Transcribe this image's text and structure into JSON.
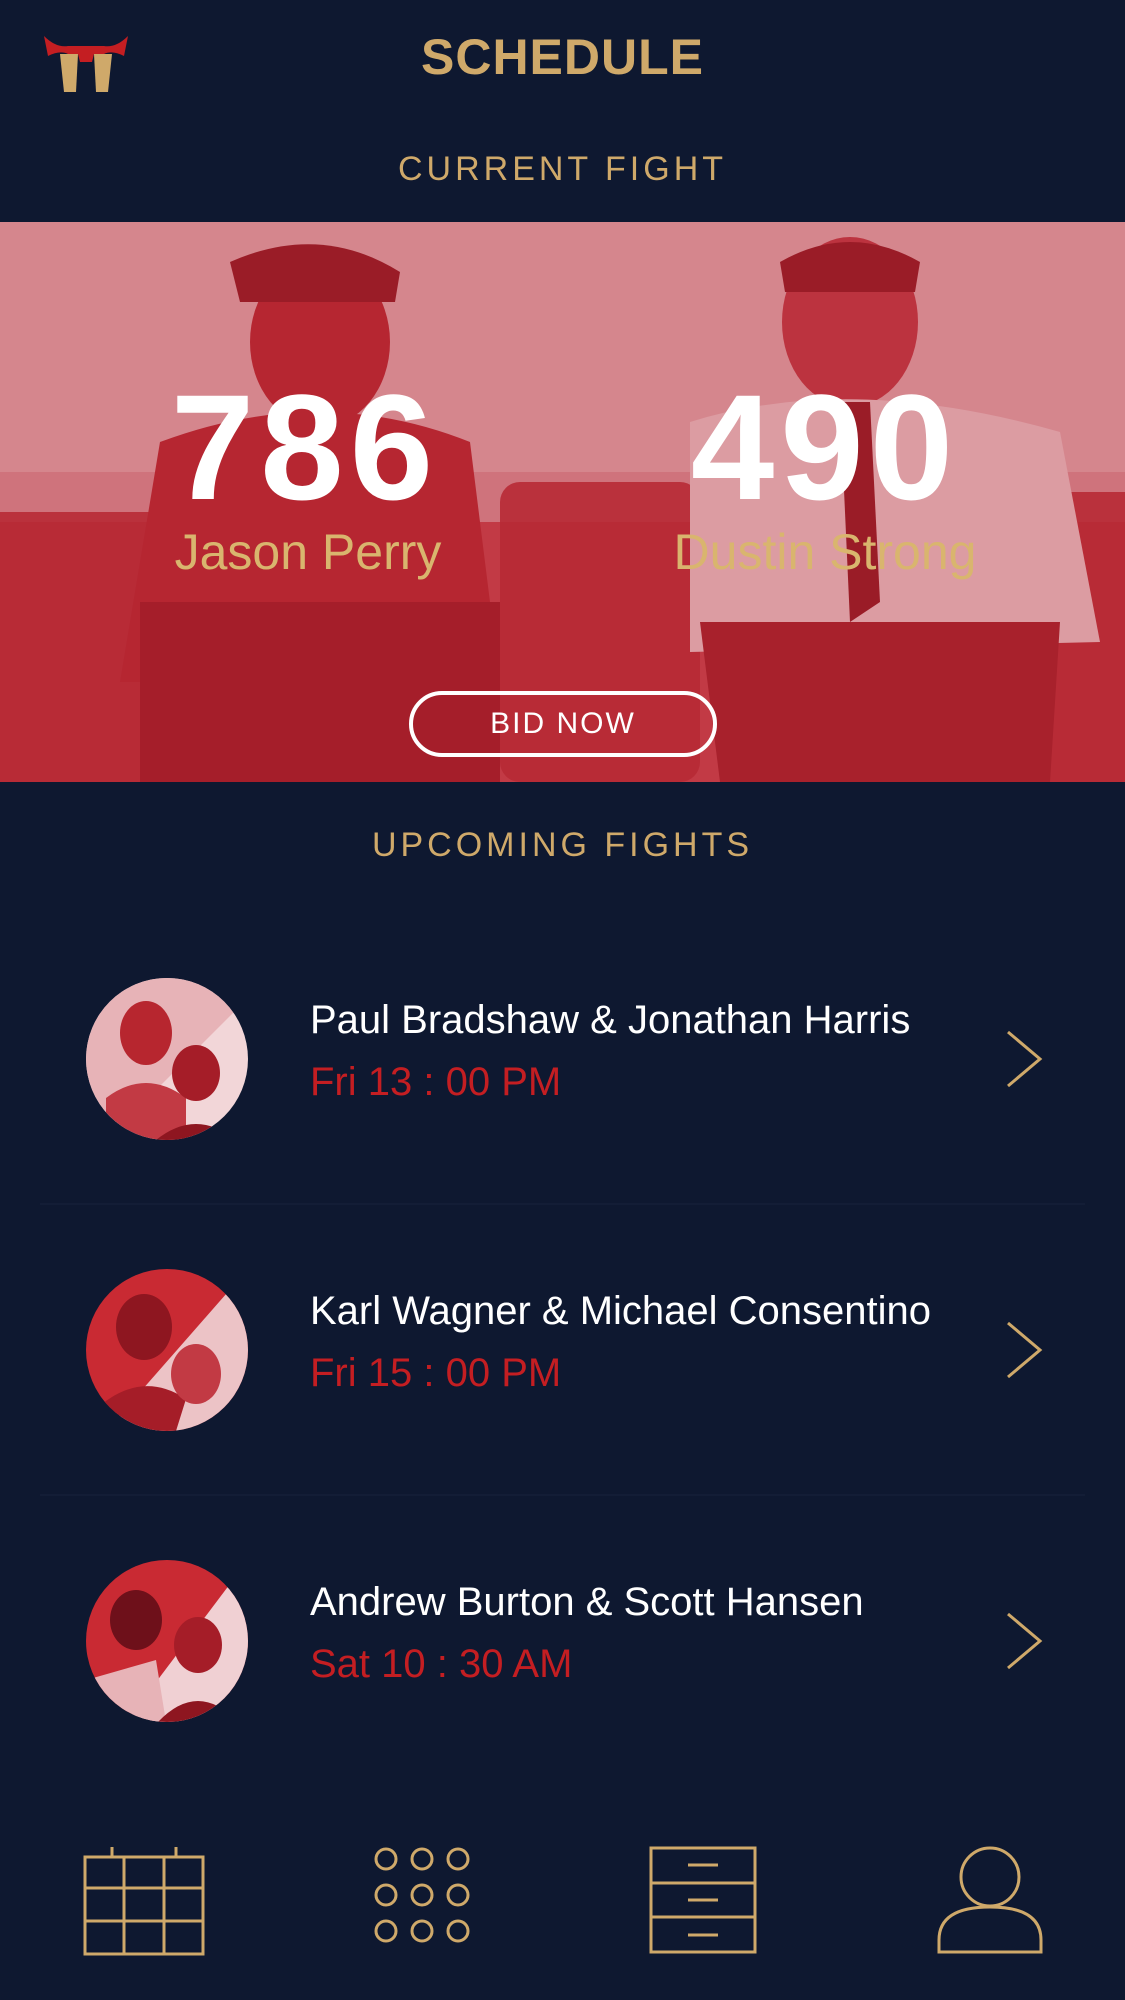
{
  "header": {
    "title": "SCHEDULE"
  },
  "current_fight": {
    "section_title": "CURRENT FIGHT",
    "fighter_left": {
      "name": "Jason Perry",
      "score": "786"
    },
    "fighter_right": {
      "name": "Dustin Strong",
      "score": "490"
    },
    "bid_label": "BID NOW"
  },
  "upcoming": {
    "section_title": "UPCOMING FIGHTS",
    "fights": [
      {
        "names": "Paul Bradshaw & Jonathan Harris",
        "time": "Fri 13 : 00 PM"
      },
      {
        "names": "Karl Wagner & Michael Consentino",
        "time": "Fri 15 : 00 PM"
      },
      {
        "names": "Andrew Burton & Scott Hansen",
        "time": "Sat 10 : 30 AM"
      }
    ]
  },
  "tabbar": {
    "items": [
      {
        "icon": "calendar-icon"
      },
      {
        "icon": "grid-dots-icon"
      },
      {
        "icon": "document-list-icon"
      },
      {
        "icon": "profile-icon"
      }
    ]
  },
  "colors": {
    "background": "#0e1830",
    "gold": "#cfa96a",
    "red": "#c41e22",
    "white": "#ffffff"
  }
}
